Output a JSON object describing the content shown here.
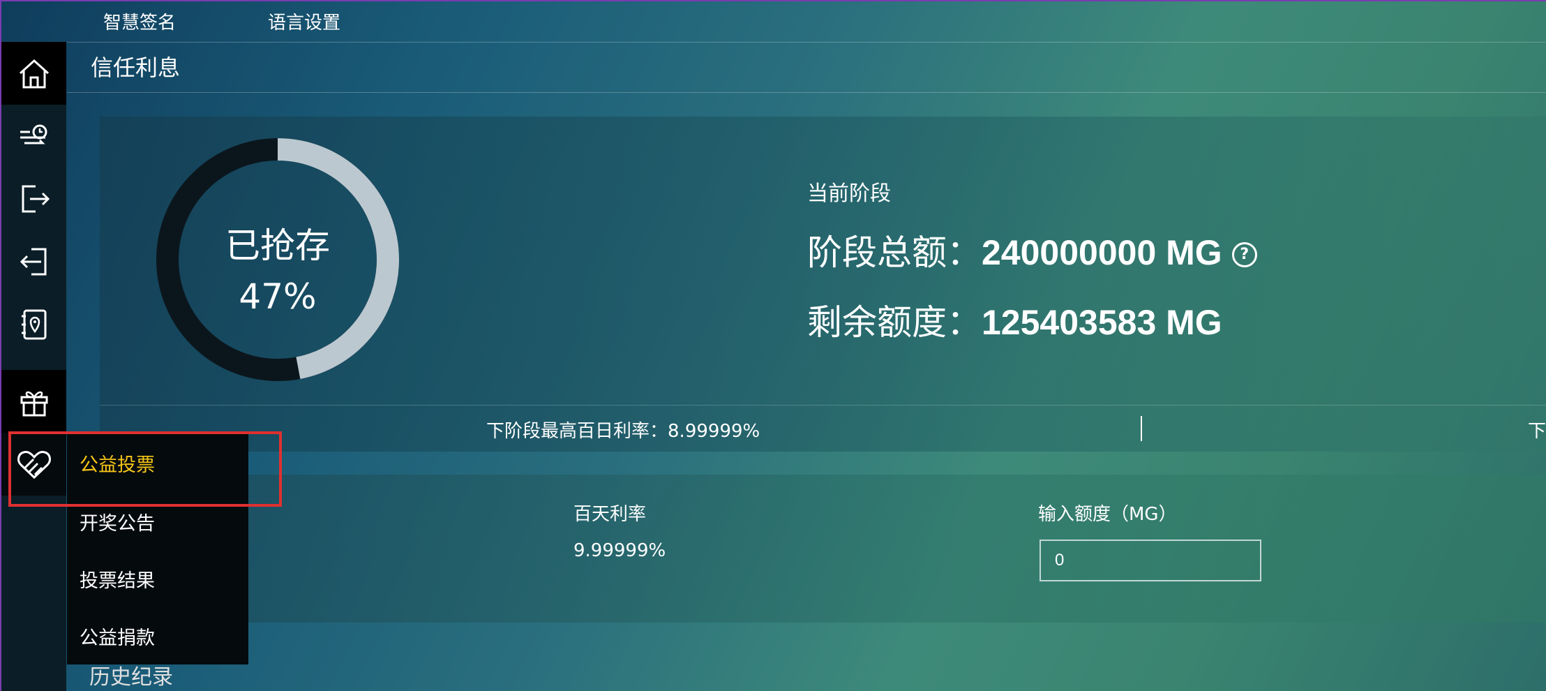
{
  "top_nav": {
    "items": [
      "智慧签名",
      "语言设置"
    ]
  },
  "page": {
    "title": "信任利息"
  },
  "progress": {
    "label": "已抢存",
    "percent_text": "47%",
    "percent": 47,
    "ring_fill_color": "#bcc8d0",
    "ring_track_color": "#0b161c"
  },
  "phase": {
    "current_label": "当前阶段",
    "total_label": "阶段总额：",
    "total_value": "240000000 MG",
    "remaining_label": "剩余额度：",
    "remaining_value": "125403583 MG",
    "help_icon": "help-circle-icon"
  },
  "next_rate": {
    "label": "下阶段最高百日利率：",
    "value": "8.99999%",
    "clipped_text": "下"
  },
  "deposit": {
    "rate_label": "百天利率",
    "rate_value": "9.99999%",
    "amount_label": "输入额度（MG）",
    "amount_value": "0"
  },
  "sidebar": {
    "icons": [
      "home-icon",
      "fast-clock-icon",
      "logout-icon",
      "login-icon",
      "address-book-icon",
      "gift-icon",
      "heart-hands-icon"
    ]
  },
  "dropdown": {
    "items": [
      "公益投票",
      "开奖公告",
      "投票结果",
      "公益捐款"
    ],
    "highlight_color": "#f5c518"
  },
  "history": {
    "label": "历史纪录"
  },
  "colors": {
    "annotation_box": "#e03030"
  }
}
